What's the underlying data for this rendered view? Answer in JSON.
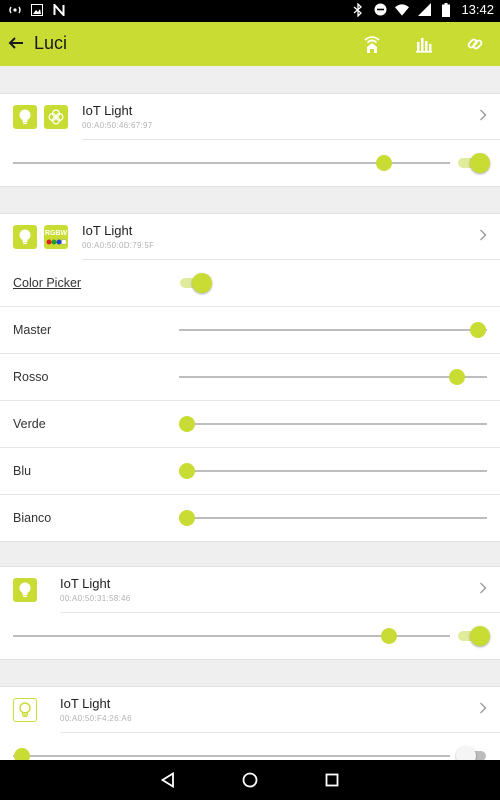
{
  "status_bar": {
    "time": "13:42"
  },
  "app_bar": {
    "title": "Luci"
  },
  "devices": [
    {
      "name": "IoT Light",
      "mac": "00:A0:50:46:67:97",
      "level": 0.85,
      "on": true
    },
    {
      "name": "IoT Light",
      "mac": "00:A0:50:0D:79:5F",
      "badge": "RGBW",
      "color_picker": {
        "label": "Color Picker",
        "on": true
      },
      "channels": [
        {
          "label": "Master",
          "level": 1.0
        },
        {
          "label": "Rosso",
          "level": 0.93
        },
        {
          "label": "Verde",
          "level": 0.0
        },
        {
          "label": "Blu",
          "level": 0.0
        },
        {
          "label": "Bianco",
          "level": 0.0
        }
      ]
    },
    {
      "name": "IoT Light",
      "mac": "00:A0:50:31:58:46",
      "level": 0.86,
      "on": true
    },
    {
      "name": "IoT Light",
      "mac": "00:A0:50:F4:26:A6",
      "level": 0.02,
      "on": false
    }
  ],
  "colors": {
    "accent": "#c9dc34",
    "background": "#efefef",
    "track": "#bdbdbd"
  }
}
